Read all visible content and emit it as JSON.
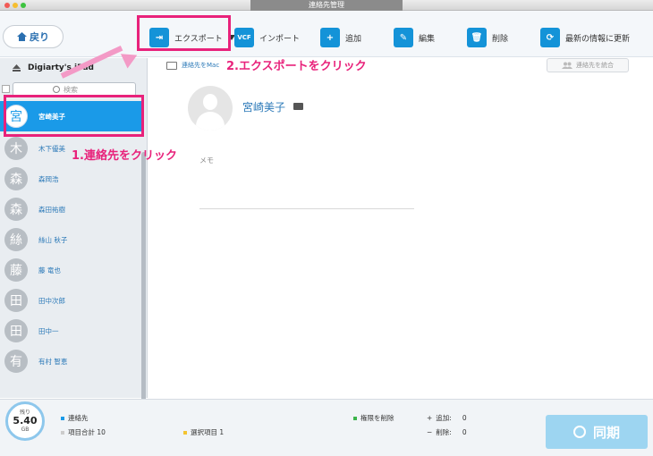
{
  "window": {
    "title": "連絡先管理"
  },
  "toolbar": {
    "back_label": "戻り",
    "export_label": "エクスポート",
    "import_label": "インポート",
    "add_label": "追加",
    "edit_label": "編集",
    "delete_label": "削除",
    "refresh_label": "最新の情報に更新"
  },
  "sidebar": {
    "device_name": "Digiarty's iPad",
    "search_placeholder": "検索",
    "contacts": [
      {
        "initial": "宮",
        "name": "宮崎美子",
        "selected": true
      },
      {
        "initial": "木",
        "name": "木下優美"
      },
      {
        "initial": "森",
        "name": "森岡浩"
      },
      {
        "initial": "森",
        "name": "森田祐樹"
      },
      {
        "initial": "絲",
        "name": "絲山 秋子"
      },
      {
        "initial": "藤",
        "name": "藤 竜也"
      },
      {
        "initial": "田",
        "name": "田中次郎"
      },
      {
        "initial": "田",
        "name": "田中一"
      },
      {
        "initial": "有",
        "name": "有村 智恵"
      }
    ]
  },
  "main": {
    "contacts_to_mac": "連絡先をMac",
    "merge_label": "連絡先を統合",
    "contact_name": "宮崎美子",
    "memo_label": "メモ"
  },
  "footer": {
    "storage_label": "残り",
    "storage_value": "5.40",
    "storage_unit": "GB",
    "contacts_label": "連絡先",
    "total_items": "項目合計 10",
    "selected_items": "選択項目 1",
    "delete_perm_label": "権限を削除",
    "add_label": "追加:",
    "add_count": "0",
    "delete_label": "削除:",
    "delete_count": "0",
    "sync_label": "同期"
  },
  "annotations": {
    "step1": "1.連絡先をクリック",
    "step2": "2.エクスポートをクリック"
  },
  "colors": {
    "accent": "#1a9ae8",
    "annotation": "#e8227b",
    "link": "#2b79b8"
  }
}
